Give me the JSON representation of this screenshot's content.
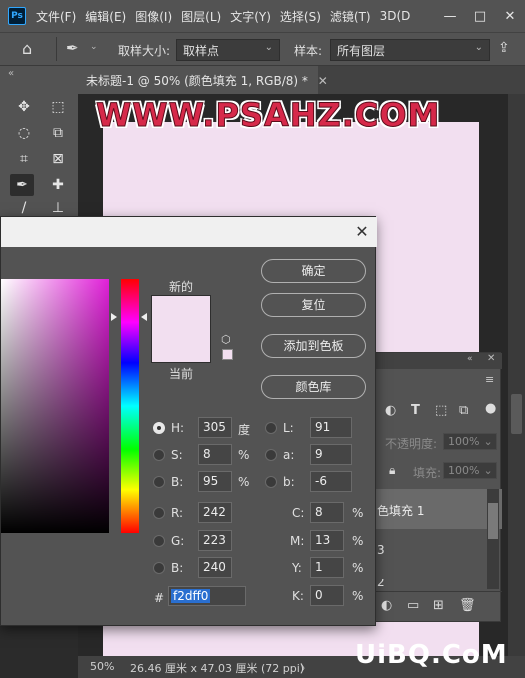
{
  "menubar": {
    "logo": "Ps",
    "items": [
      "文件(F)",
      "编辑(E)",
      "图像(I)",
      "图层(L)",
      "文字(Y)",
      "选择(S)",
      "滤镜(T)",
      "3D(D"
    ],
    "min": "—",
    "max": "□",
    "close": "✕"
  },
  "options": {
    "sample_size_label": "取样大小:",
    "sample_size_value": "取样点",
    "sample_label": "样本:",
    "sample_value": "所有图层"
  },
  "document": {
    "tab_title": "未标题-1 @ 50% (颜色填充 1, RGB/8) *",
    "tab_close": "✕",
    "canvas_color": "#f2dff0"
  },
  "watermark": "WWW.PSAHZ.COM",
  "corner_logo": "UiBQ.CoM",
  "status": {
    "zoom": "50%",
    "info": "26.46 厘米 x 47.03 厘米 (72 ppi)",
    "arrow": "〉"
  },
  "layers_panel": {
    "opacity_label": "不透明度:",
    "opacity_value": "100%",
    "fill_label": "填充:",
    "fill_value": "100%",
    "items": [
      "色填充 1",
      "3",
      "2"
    ]
  },
  "color_picker": {
    "close": "✕",
    "new_label": "新的",
    "current_label": "当前",
    "ok_button": "确定",
    "reset_button": "复位",
    "add_swatch_button": "添加到色板",
    "libraries_button": "颜色库",
    "hsb": {
      "H": {
        "label": "H:",
        "value": "305",
        "unit": "度"
      },
      "S": {
        "label": "S:",
        "value": "8",
        "unit": "%"
      },
      "B": {
        "label": "B:",
        "value": "95",
        "unit": "%"
      }
    },
    "lab": {
      "L": {
        "label": "L:",
        "value": "91"
      },
      "a": {
        "label": "a:",
        "value": "9"
      },
      "b": {
        "label": "b:",
        "value": "-6"
      }
    },
    "rgb": {
      "R": {
        "label": "R:",
        "value": "242"
      },
      "G": {
        "label": "G:",
        "value": "223"
      },
      "B": {
        "label": "B:",
        "value": "240"
      }
    },
    "cmyk": {
      "C": {
        "label": "C:",
        "value": "8",
        "unit": "%"
      },
      "M": {
        "label": "M:",
        "value": "13",
        "unit": "%"
      },
      "Y": {
        "label": "Y:",
        "value": "1",
        "unit": "%"
      },
      "K": {
        "label": "K:",
        "value": "0",
        "unit": "%"
      }
    },
    "hex_label": "#",
    "hex_value": "f2dff0"
  }
}
